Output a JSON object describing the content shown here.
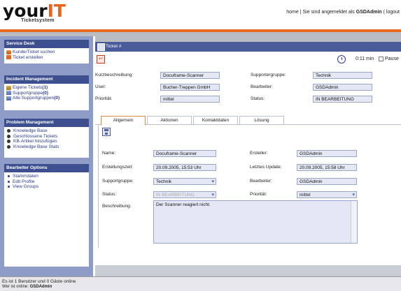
{
  "header": {
    "logo_your": "your",
    "logo_it": "IT",
    "logo_sub": "Ticketsystem",
    "home_link": "home",
    "separator": " | ",
    "logged_in_prefix": "Sie sind angemeldet als ",
    "user": "GSDAdmin",
    "logout": " ( logout"
  },
  "sidebar": {
    "service_desk": {
      "title": "Service Desk",
      "items": [
        "Kunde/Ticket suchen",
        "Ticket erstellen"
      ]
    },
    "incident": {
      "title": "Incident Management",
      "items": [
        {
          "label": "Eigene Tickets ",
          "count": "(1)"
        },
        {
          "label": "Supportgruppe ",
          "count": "(0)"
        },
        {
          "label": "Alle Supportgruppen ",
          "count": "(0)"
        }
      ]
    },
    "problem": {
      "title": "Problem Management",
      "items": [
        "Knowledge Base",
        "Geschlossene Tickets",
        "KB-Artikel hinzufügen",
        "Knowledge Base Stats"
      ]
    },
    "options": {
      "title": "Bearbeiter Options",
      "items": [
        "Stammdaten",
        "Edit Profile",
        "View Groups"
      ]
    }
  },
  "ticket": {
    "header_title": "Ticket #",
    "timer": "0:11 min",
    "pause_label": "Pause",
    "info": {
      "kurzbeschreibung_label": "Kurzbeschreibung:",
      "kurzbeschreibung": "Docuframe-Scanner",
      "user_label": "User:",
      "user": "Bucher-Treppen GmbH",
      "prioritaet_label": "Priorität:",
      "prioritaet": "mittel",
      "supportgruppe_label": "Supportergruppe:",
      "supportgruppe": "Technik",
      "bearbeiter_label": "Bearbeiter:",
      "bearbeiter": "GSDAdmin",
      "status_label": "Status:",
      "status": "IN BEARBEITUNG"
    },
    "tabs": [
      "Allgemein",
      "Aktionen",
      "Kontaktdaten",
      "Lösung"
    ],
    "form": {
      "name_label": "Name:",
      "name": "Docuframe-Scanner",
      "erstellzeit_label": "Erstellungszeit:",
      "erstellzeit": "20.09.2005, 15:53 Uhr",
      "supportgruppe_label": "Supportgruppe:",
      "supportgruppe": "Technik",
      "status_label": "Status:",
      "status": "IN BEARBEITUNG",
      "beschreibung_label": "Beschreibung:",
      "beschreibung": "Der Scanner reagiert nicht.",
      "ersteller_label": "Ersteller:",
      "ersteller": "GSDAdmin",
      "update_label": "Letztes Update:",
      "update": "20.09.2005, 15:58 Uhr",
      "bearbeiter_label": "Bearbeiter:",
      "bearbeiter": "GSDAdmin",
      "prioritaet_label": "Priorität:",
      "prioritaet": "mittel"
    }
  },
  "footer": {
    "line1": "Es ist 1 Benutzer und 0 Gäste online",
    "line2_prefix": "Wer ist online: ",
    "line2_user": "GSDAdmin"
  }
}
